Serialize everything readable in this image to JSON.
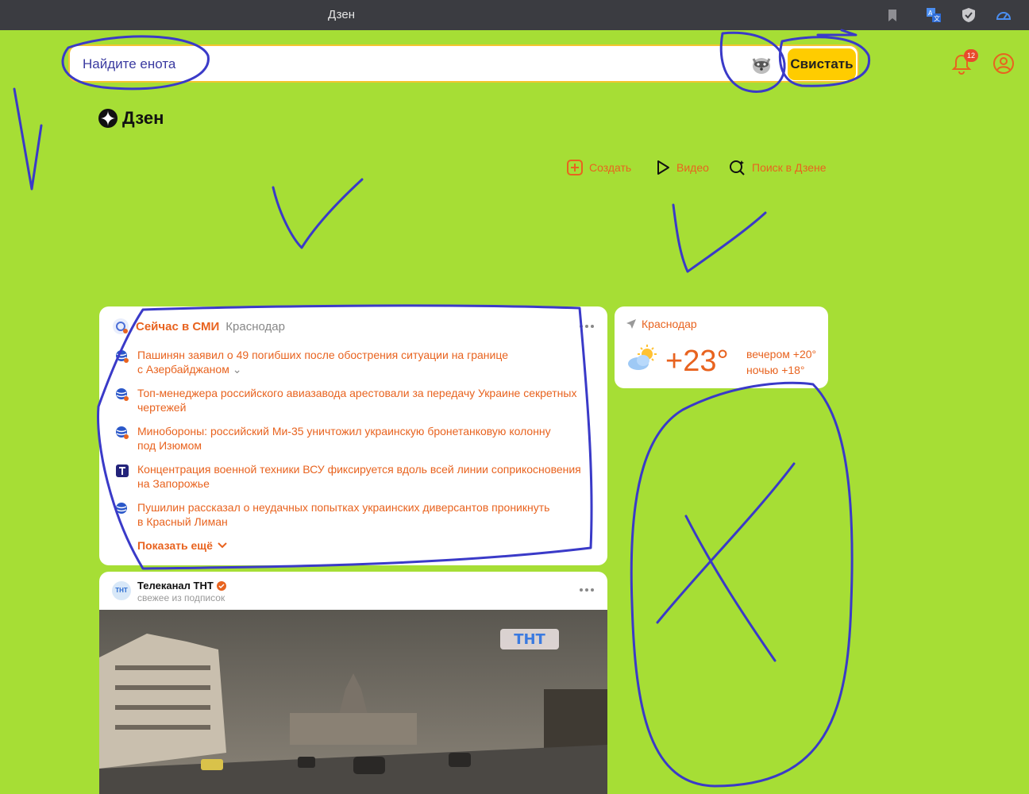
{
  "window": {
    "title": "Дзен"
  },
  "search": {
    "placeholder": "Найдите енота",
    "button": "Свистать"
  },
  "header": {
    "notifications_count": "12"
  },
  "logo": {
    "text": "Дзен"
  },
  "actions": [
    {
      "label": "Создать",
      "icon": "plus-square-icon"
    },
    {
      "label": "Видео",
      "icon": "play-icon"
    },
    {
      "label": "Поиск в Дзене",
      "icon": "search-sparkle-icon"
    }
  ],
  "news": {
    "title": "Сейчас в СМИ",
    "city": "Краснодар",
    "items": [
      {
        "line1": "Пашинян заявил о 49 погибших после обострения ситуации на границе",
        "line2": "с Азербайджаном"
      },
      {
        "line1": "Топ-менеджера российского авиазавода арестовали за передачу Украине секретных",
        "line2": "чертежей"
      },
      {
        "line1": "Минобороны: российский Ми-35 уничтожил украинскую бронетанковую колонну",
        "line2": "под Изюмом"
      },
      {
        "line1": "Концентрация военной техники ВСУ фиксируется вдоль всей линии соприкосновения",
        "line2": "на Запорожье"
      },
      {
        "line1": "Пушилин рассказал о неудачных попытках украинских диверсантов проникнуть",
        "line2": "в Красный Лиман"
      }
    ],
    "show_more": "Показать ещё"
  },
  "weather": {
    "city": "Краснодар",
    "temp": "+23°",
    "evening": "вечером +20°",
    "night": "ночью +18°"
  },
  "channel": {
    "name": "Телеканал ТНТ",
    "subtitle": "свежее из подписок",
    "avatar_text": "ТНТ",
    "video_logo": "ТНТ"
  },
  "colors": {
    "background": "#a6de35",
    "accent": "#e8631f",
    "button": "#ffcc00",
    "annotation": "#3a3ac8"
  }
}
